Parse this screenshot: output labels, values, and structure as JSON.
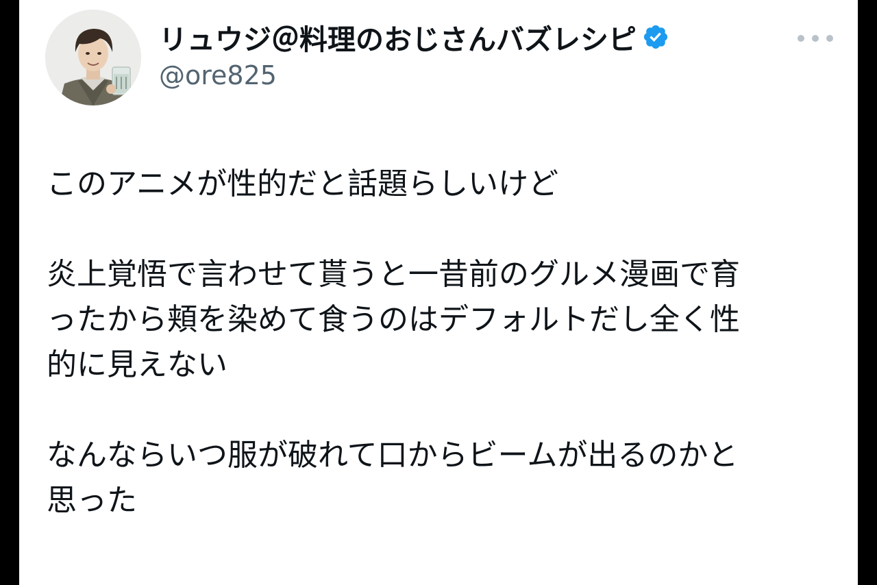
{
  "user": {
    "display_name": "リュウジ＠料理のおじさんバズレシピ",
    "handle": "@ore825",
    "verified": true,
    "verified_color": "#1d9bf0"
  },
  "menu": {
    "icon": "more-horizontal-icon"
  },
  "tweet": {
    "lines": [
      "このアニメが性的だと話題らしいけど",
      "",
      "炎上覚悟で言わせて貰うと一昔前のグルメ漫画で育",
      "ったから頬を染めて食うのはデフォルトだし全く性",
      "的に見えない",
      "",
      "なんならいつ服が破れて口からビームが出るのかと",
      "思った"
    ]
  },
  "colors": {
    "text": "#0f1419",
    "secondary": "#536471",
    "background": "#ffffff",
    "frame": "#000000"
  }
}
